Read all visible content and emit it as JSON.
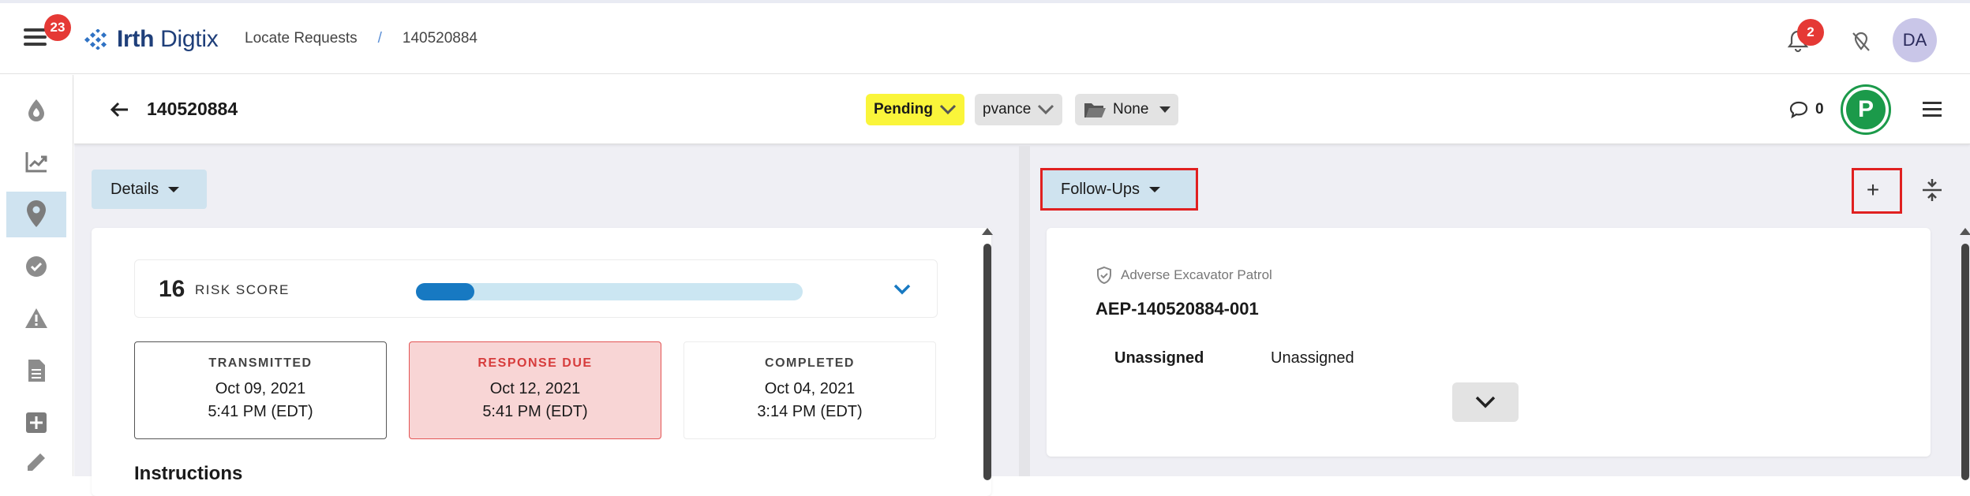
{
  "topbar": {
    "menu_badge": "23",
    "logo_text_bold": "Irth",
    "logo_text_rest": " Digtix",
    "breadcrumb": [
      "Locate Requests",
      "/",
      "140520884"
    ],
    "notification_badge": "2",
    "avatar_initials": "DA"
  },
  "sidebar": {
    "items": [
      {
        "icon": "drop-icon"
      },
      {
        "icon": "chart-icon"
      },
      {
        "icon": "map-pin-icon",
        "active": true
      },
      {
        "icon": "check-circle-icon"
      },
      {
        "icon": "warning-icon"
      },
      {
        "icon": "document-icon"
      },
      {
        "icon": "plus-box-icon"
      },
      {
        "icon": "pen-icon"
      }
    ]
  },
  "subheader": {
    "title": "140520884",
    "status": "Pending",
    "status_color": "#faf53a",
    "user": "pvance",
    "folder": "None",
    "comment_count": "0",
    "profile_letter": "P",
    "profile_color": "#1b9a4a"
  },
  "left_pane": {
    "dropdown_label": "Details",
    "risk_score": "16",
    "risk_label": "RISK SCORE",
    "risk_fraction": 0.15,
    "dates": [
      {
        "label": "TRANSMITTED",
        "date": "Oct 09, 2021",
        "time": "5:41 PM (EDT)"
      },
      {
        "label": "RESPONSE DUE",
        "date": "Oct 12, 2021",
        "time": "5:41 PM (EDT)"
      },
      {
        "label": "COMPLETED",
        "date": "Oct 04, 2021",
        "time": "3:14 PM (EDT)"
      }
    ],
    "instructions_heading": "Instructions"
  },
  "right_pane": {
    "dropdown_label": "Follow-Ups",
    "add_label": "+",
    "followup": {
      "type": "Adverse Excavator Patrol",
      "id": "AEP-140520884-001",
      "assignee_1": "Unassigned",
      "assignee_2": "Unassigned"
    }
  }
}
